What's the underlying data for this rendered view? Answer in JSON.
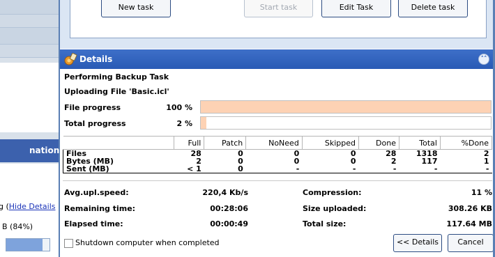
{
  "sidebar": {
    "nav_label": "nation",
    "hide_prefix": "g (",
    "hide_link": "Hide Details",
    "percent_text": "B (84%)",
    "progress": 0.84
  },
  "tasks": {
    "new_task": "New task",
    "start_task": "Start task",
    "edit_task": "Edit Task",
    "delete_task": "Delete task"
  },
  "details": {
    "title": "Details",
    "collapse_icon": "chevron-double-up-icon",
    "header_icon": "details-icon",
    "status": "Performing Backup Task",
    "current_file": "Uploading File 'Basic.icl'",
    "file_progress_label": "File progress",
    "file_progress_value": "100 %",
    "file_progress": 1.0,
    "total_progress_label": "Total progress",
    "total_progress_value": "2 %",
    "total_progress": 0.02,
    "table": {
      "columns": [
        "",
        "Full",
        "Patch",
        "NoNeed",
        "Skipped",
        "Done",
        "Total",
        "%Done"
      ],
      "rows": [
        [
          "Files",
          "28",
          "0",
          "0",
          "0",
          "28",
          "1318",
          "2"
        ],
        [
          "Bytes (MB)",
          "2",
          "0",
          "0",
          "0",
          "2",
          "117",
          "1"
        ],
        [
          "Sent (MB)",
          "< 1",
          "0",
          "-",
          "-",
          "-",
          "-",
          "-"
        ]
      ]
    },
    "avg_speed_label": "Avg.upl.speed:",
    "avg_speed_value": "220,4 Kb/s",
    "remaining_label": "Remaining time:",
    "remaining_value": "00:28:06",
    "elapsed_label": "Elapsed time:",
    "elapsed_value": "00:00:49",
    "compression_label": "Compression:",
    "compression_value": "11 %",
    "size_uploaded_label": "Size uploaded:",
    "size_uploaded_value": "308.26 KB",
    "total_size_label": "Total size:",
    "total_size_value": "117.64 MB",
    "shutdown_label": "Shutdown computer when completed",
    "details_button": "<< Details",
    "cancel_button": "Cancel"
  },
  "colors": {
    "header": "#295ab5",
    "progress_fill": "#fdd2b4",
    "nav_selected": "#3c61ad"
  }
}
